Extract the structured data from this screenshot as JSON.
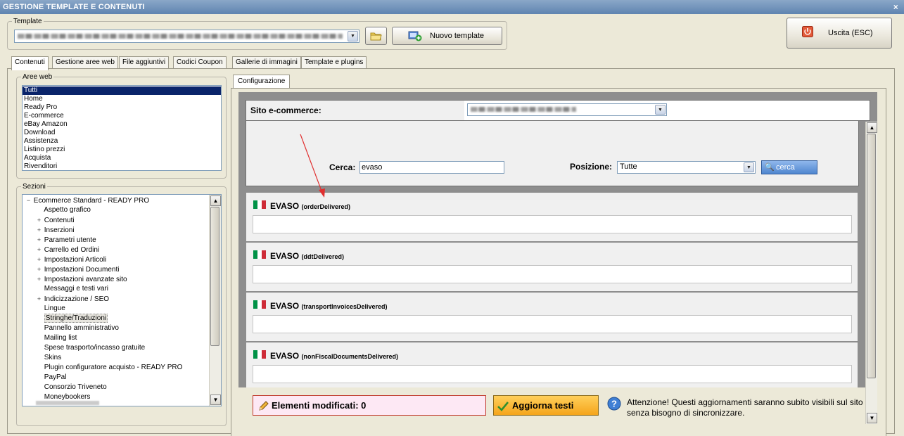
{
  "window": {
    "title": "GESTIONE TEMPLATE E CONTENUTI",
    "close_glyph": "×"
  },
  "template_group": {
    "legend": "Template",
    "new_button": "Nuovo template"
  },
  "exit_button": "Uscita (ESC)",
  "tabs": [
    {
      "label": "Contenuti",
      "active": true
    },
    {
      "label": "Gestione aree web"
    },
    {
      "label": "File aggiuntivi"
    },
    {
      "label": "Codici Coupon"
    },
    {
      "label": "Gallerie di immagini"
    },
    {
      "label": "Template e plugins"
    }
  ],
  "aree_web": {
    "legend": "Aree web",
    "items": [
      "Tutti",
      "Home",
      "Ready Pro",
      "E-commerce",
      "eBay Amazon",
      "Download",
      "Assistenza",
      "Listino prezzi",
      "Acquista",
      "Rivenditori"
    ],
    "selected": "Tutti"
  },
  "sezioni": {
    "legend": "Sezioni",
    "root": "Ecommerce Standard - READY PRO",
    "items": [
      {
        "label": "Aspetto grafico",
        "expand": ""
      },
      {
        "label": "Contenuti",
        "expand": "+"
      },
      {
        "label": "Inserzioni",
        "expand": "+"
      },
      {
        "label": "Parametri utente",
        "expand": "+"
      },
      {
        "label": "Carrello ed Ordini",
        "expand": "+"
      },
      {
        "label": "Impostazioni Articoli",
        "expand": "+"
      },
      {
        "label": "Impostazioni Documenti",
        "expand": "+"
      },
      {
        "label": "Impostazioni avanzate sito",
        "expand": "+"
      },
      {
        "label": "Messaggi e testi vari",
        "expand": ""
      },
      {
        "label": "Indicizzazione / SEO",
        "expand": "+"
      },
      {
        "label": "Lingue",
        "expand": ""
      },
      {
        "label": "Stringhe/Traduzioni",
        "expand": "",
        "selected": true
      },
      {
        "label": "Pannello amministrativo",
        "expand": ""
      },
      {
        "label": "Mailing list",
        "expand": ""
      },
      {
        "label": "Spese trasporto/incasso gratuite",
        "expand": ""
      },
      {
        "label": "Skins",
        "expand": ""
      },
      {
        "label": "Plugin configuratore acquisto - READY PRO",
        "expand": ""
      },
      {
        "label": "PayPal",
        "expand": ""
      },
      {
        "label": "Consorzio Triveneto",
        "expand": ""
      },
      {
        "label": "Moneybookers",
        "expand": ""
      }
    ]
  },
  "config": {
    "tab": "Configurazione",
    "site_label": "Sito e-commerce:",
    "search_label": "Cerca:",
    "search_value": "evaso",
    "position_label": "Posizione:",
    "position_value": "Tutte",
    "search_button": "cerca",
    "records": [
      {
        "title": "EVASO",
        "key": "(orderDelivered)"
      },
      {
        "title": "EVASO",
        "key": "(ddtDelivered)"
      },
      {
        "title": "EVASO",
        "key": "(transportInvoicesDelivered)"
      },
      {
        "title": "EVASO",
        "key": "(nonFiscalDocumentsDelivered)"
      }
    ]
  },
  "footer": {
    "modified_label": "Elementi modificati: 0",
    "update_button": "Aggiorna testi",
    "notice_line1": "Attenzione! Questi aggiornamenti saranno subito visibili sul sito",
    "notice_line2": "senza bisogno di sincronizzare."
  },
  "colors": {
    "accent": "#0a246a",
    "flag": [
      "#009246",
      "#ffffff",
      "#ce2b37"
    ],
    "annotation_arrow": "#e03030"
  }
}
